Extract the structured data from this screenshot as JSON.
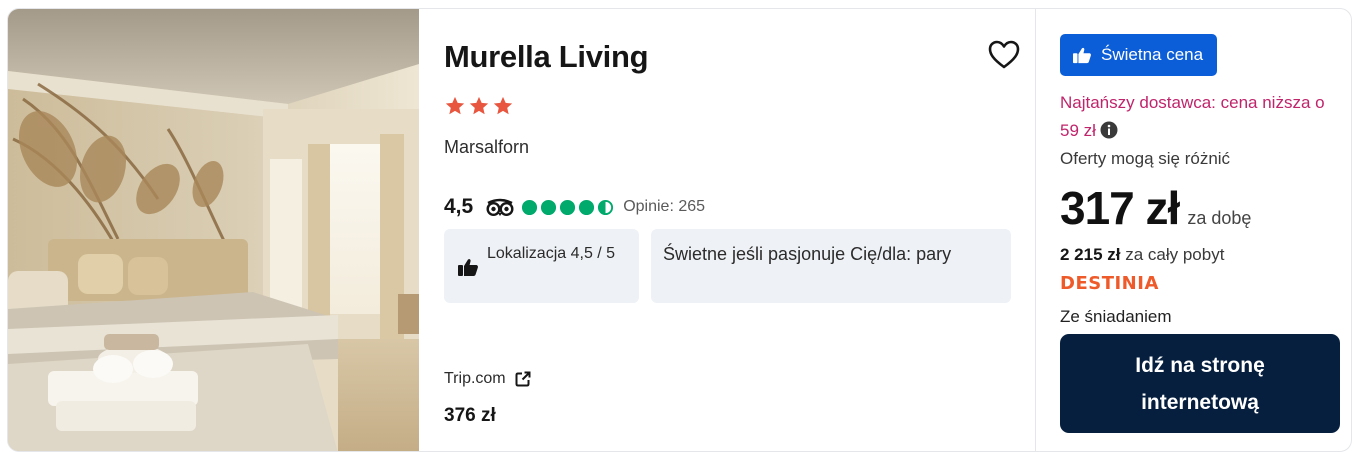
{
  "hotel": {
    "name": "Murella Living",
    "stars": 3,
    "location": "Marsalforn",
    "rating": "4,5",
    "bubble_score": 4.5,
    "reviews_label": "Opinie: 265"
  },
  "highlights": {
    "location_chip": "Lokalizacja 4,5 / 5",
    "good_for_chip": "Świetne jeśli pasjonuje Cię/dla: pary"
  },
  "alt_offer": {
    "provider": "Trip.com",
    "price": "376 zł"
  },
  "offer": {
    "badge": "Świetna cena",
    "cheapest_note": "Najtańszy dostawca: cena niższa o 59 zł",
    "disclaimer": "Oferty mogą się różnić",
    "price": "317 zł",
    "per_night": "za dobę",
    "total_amount": "2 215 zł",
    "total_label": " za cały pobyt",
    "provider_logo_text": "Destinia",
    "board": "Ze śniadaniem",
    "cta": "Idź na stronę internetową"
  },
  "icons": {
    "favorite": "heart-outline-icon",
    "tripadvisor": "tripadvisor-owl-icon",
    "thumbs_up": "thumbs-up-icon",
    "external": "external-link-icon",
    "info": "info-circle-icon"
  },
  "colors": {
    "star": "#e8563f",
    "bubble": "#00aa6c",
    "badge": "#0b5ed7",
    "cheap_text": "#c0246b",
    "brand": "#ef5a2a",
    "cta": "#061f3e"
  }
}
